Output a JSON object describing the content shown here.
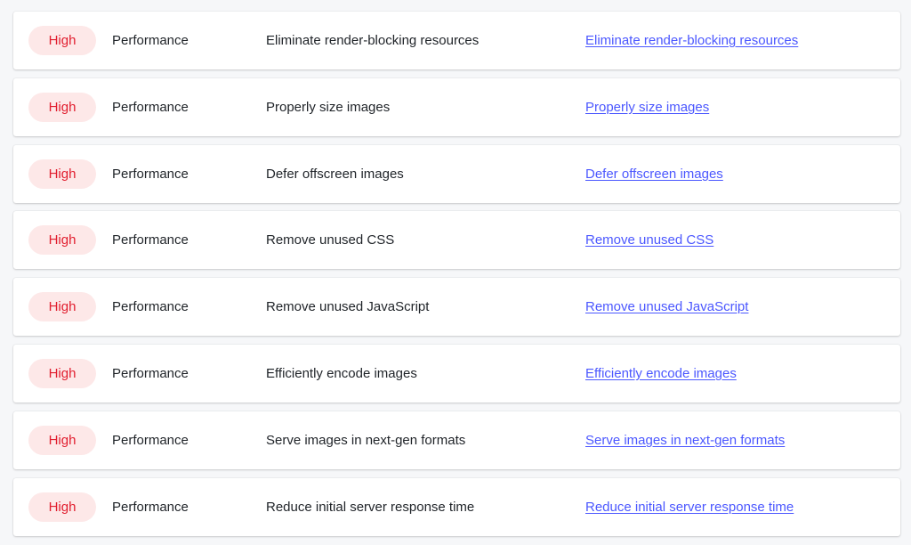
{
  "colors": {
    "page_background": "#f6f7f9",
    "card_background": "#ffffff",
    "badge_high_text": "#e11d2e",
    "badge_high_background": "#fde8e8",
    "link": "#4b57ff"
  },
  "rows": [
    {
      "severity": "High",
      "category": "Performance",
      "title": "Eliminate render-blocking resources",
      "link_text": "Eliminate render-blocking resources"
    },
    {
      "severity": "High",
      "category": "Performance",
      "title": "Properly size images",
      "link_text": "Properly size images"
    },
    {
      "severity": "High",
      "category": "Performance",
      "title": "Defer offscreen images",
      "link_text": "Defer offscreen images"
    },
    {
      "severity": "High",
      "category": "Performance",
      "title": "Remove unused CSS",
      "link_text": "Remove unused CSS"
    },
    {
      "severity": "High",
      "category": "Performance",
      "title": "Remove unused JavaScript",
      "link_text": "Remove unused JavaScript"
    },
    {
      "severity": "High",
      "category": "Performance",
      "title": "Efficiently encode images",
      "link_text": "Efficiently encode images"
    },
    {
      "severity": "High",
      "category": "Performance",
      "title": "Serve images in next-gen formats",
      "link_text": "Serve images in next-gen formats"
    },
    {
      "severity": "High",
      "category": "Performance",
      "title": "Reduce initial server response time",
      "link_text": "Reduce initial server response time"
    }
  ]
}
